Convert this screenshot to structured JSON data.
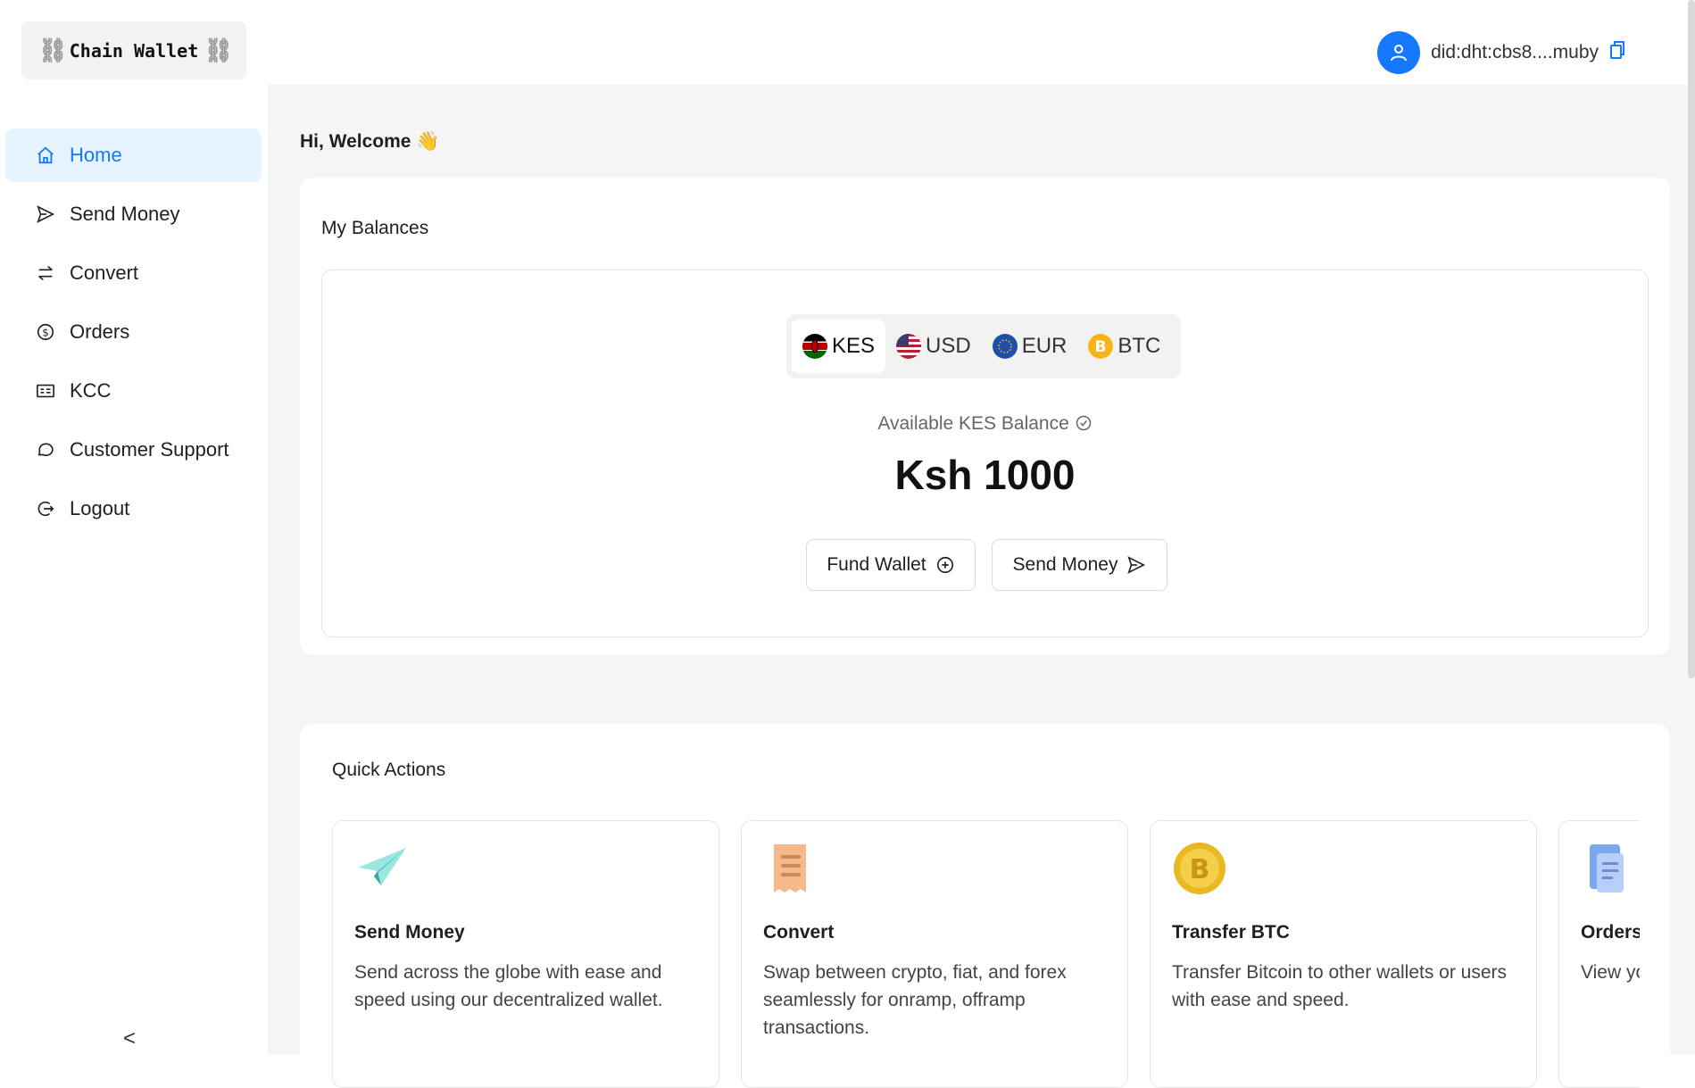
{
  "app": {
    "logo_text": "Chain Wallet",
    "logo_chain": "⛓"
  },
  "sidebar": {
    "items": [
      {
        "label": "Home",
        "icon": "home-icon",
        "active": true
      },
      {
        "label": "Send Money",
        "icon": "send-icon"
      },
      {
        "label": "Convert",
        "icon": "swap-icon"
      },
      {
        "label": "Orders",
        "icon": "dollar-circle-icon"
      },
      {
        "label": "KCC",
        "icon": "id-card-icon"
      },
      {
        "label": "Customer Support",
        "icon": "chat-icon"
      },
      {
        "label": "Logout",
        "icon": "logout-icon"
      }
    ],
    "collapse_glyph": "<"
  },
  "header": {
    "user_did": "did:dht:cbs8....muby"
  },
  "main": {
    "welcome": "Hi, Welcome 👋",
    "balances": {
      "title": "My Balances",
      "currencies": [
        {
          "code": "KES",
          "active": true
        },
        {
          "code": "USD"
        },
        {
          "code": "EUR"
        },
        {
          "code": "BTC"
        }
      ],
      "available_label": "Available KES Balance",
      "amount": "Ksh 1000",
      "fund_label": "Fund Wallet",
      "send_label": "Send Money"
    },
    "quick_actions": {
      "title": "Quick Actions",
      "items": [
        {
          "title": "Send Money",
          "desc": "Send across the globe with ease and speed using our decentralized wallet.",
          "icon": "paper-plane-icon"
        },
        {
          "title": "Convert",
          "desc": "Swap between crypto, fiat, and forex seamlessly for onramp, offramp transactions.",
          "icon": "receipt-icon"
        },
        {
          "title": "Transfer BTC",
          "desc": "Transfer Bitcoin to other wallets or users with ease and speed.",
          "icon": "bitcoin-coin-icon"
        },
        {
          "title": "Orders",
          "desc": "View your onramp and offramp orders",
          "icon": "document-scroll-icon"
        }
      ]
    }
  },
  "colors": {
    "accent": "#1677ff",
    "active_bg": "#e6f4ff",
    "page_bg": "#f5f5f5"
  }
}
